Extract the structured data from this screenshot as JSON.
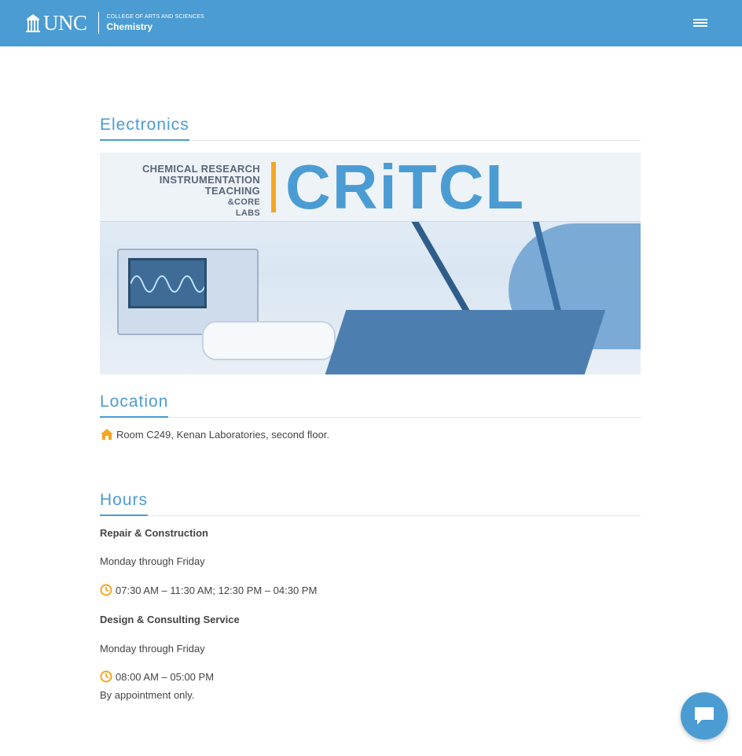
{
  "header": {
    "logo_unc": "UNC",
    "logo_college": "COLLEGE OF ARTS AND SCIENCES",
    "logo_dept": "Chemistry",
    "menu_icon": "hamburger-menu-icon"
  },
  "page": {
    "title": "Electronics"
  },
  "banner": {
    "left_lines": [
      "CHEMICAL RESEARCH",
      "INSTRUMENTATION",
      "TEACHING",
      "&CORE",
      "LABS"
    ],
    "brand": "CRiTCL"
  },
  "location": {
    "title": "Location",
    "icon": "home-icon",
    "text": "Room C249, Kenan Laboratories, second floor."
  },
  "hours": {
    "title": "Hours",
    "repair_label": "Repair & Construction",
    "repair_days": "Monday through Friday",
    "repair_times": "07:30 AM – 11:30 AM; 12:30 PM – 04:30 PM",
    "design_label": "Design & Consulting Service",
    "design_days": "Monday through Friday",
    "design_times": "08:00 AM – 05:00 PM",
    "design_note": "By appointment only."
  },
  "colors": {
    "brand_blue": "#4b9cd3",
    "accent_orange": "#f5a623"
  },
  "chat": {
    "icon": "chat-icon"
  }
}
